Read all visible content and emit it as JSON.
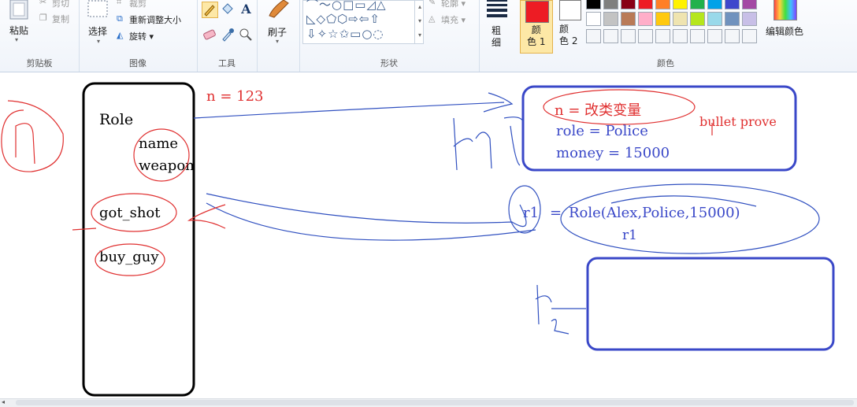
{
  "ribbon": {
    "clipboard": {
      "paste": "粘贴",
      "cut": "剪切",
      "copy": "复制",
      "label": "剪贴板"
    },
    "image": {
      "select": "选择",
      "crop": "裁剪",
      "resize": "重新调整大小",
      "rotate": "旋转 ▾",
      "label": "图像"
    },
    "tools": {
      "label": "工具"
    },
    "brushes": {
      "label": "刷子"
    },
    "shapes": {
      "outline": "轮廓 ▾",
      "fill": "填充 ▾",
      "label": "形状"
    },
    "size": {
      "label": "粗\n细"
    },
    "color1": {
      "label": "颜\n色 1"
    },
    "color2": {
      "label": "颜\n色 2"
    },
    "colors": {
      "label": "颜色",
      "edit": "编辑颜色"
    }
  },
  "palette": {
    "row1": [
      "#000000",
      "#7f7f7f",
      "#880015",
      "#ed1c24",
      "#ff7f27",
      "#fff200",
      "#22b14c",
      "#00a2e8",
      "#3f48cc",
      "#a349a4"
    ],
    "row2": [
      "#ffffff",
      "#c3c3c3",
      "#b97a57",
      "#ffaec9",
      "#ffc90e",
      "#efe4b0",
      "#b5e61d",
      "#99d9ea",
      "#7092be",
      "#c8bfe7"
    ],
    "color1": "#ed1c24",
    "color2": "#ffffff"
  },
  "canvas": {
    "role_title": "Role",
    "attr_name": "name",
    "attr_weapon": "weapon",
    "method_got_shot": "got_shot",
    "method_buy_guy": "buy_guy",
    "n_assign": "n = 123",
    "obj_n": "n = 改类变量",
    "obj_role": "role = Police",
    "obj_money": "money = 15000",
    "bullet_note": "bullet prove",
    "r1_label": "r1",
    "r1_call": "Role(Alex,Police,15000)",
    "r1_under": "r1"
  }
}
